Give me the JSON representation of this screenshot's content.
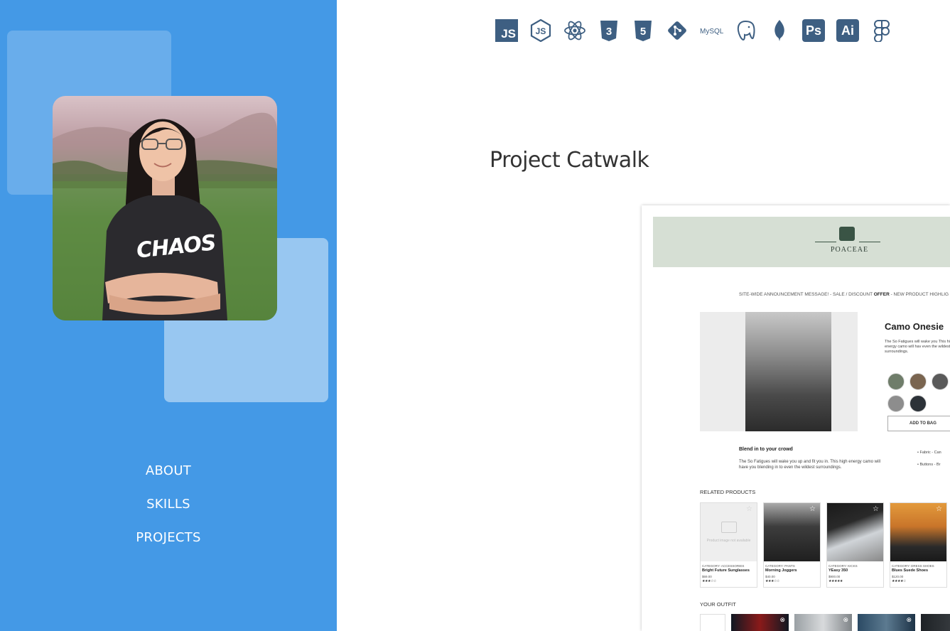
{
  "sidebar": {
    "nav": [
      {
        "label": "ABOUT"
      },
      {
        "label": "SKILLS"
      },
      {
        "label": "PROJECTS"
      }
    ],
    "portrait_shirt_text": "CHAOS",
    "colors": {
      "background": "#4499e6"
    }
  },
  "skills": [
    {
      "icon": "javascript-icon",
      "label": "JS"
    },
    {
      "icon": "nodejs-icon",
      "label": "JS"
    },
    {
      "icon": "react-icon"
    },
    {
      "icon": "css3-icon",
      "label": "3"
    },
    {
      "icon": "html5-icon",
      "label": "5"
    },
    {
      "icon": "git-icon"
    },
    {
      "icon": "mysql-icon",
      "label": "MySQL"
    },
    {
      "icon": "postgresql-icon"
    },
    {
      "icon": "mongodb-icon"
    },
    {
      "icon": "photoshop-icon",
      "label": "Ps"
    },
    {
      "icon": "illustrator-icon",
      "label": "Ai"
    },
    {
      "icon": "figma-icon"
    }
  ],
  "project": {
    "title": "Project Catwalk",
    "screenshot": {
      "brand": "POACEAE",
      "announcement_pre": "SITE-WIDE ANNOUNCEMENT MESSAGE! - SALE / DISCOUNT ",
      "announcement_bold": "OFFER",
      "announcement_post": " - NEW PRODUCT HIGHLIG",
      "product_name": "Camo Onesie",
      "product_desc": "The So Fatigues will wake you This high energy camo will hav even the wildest surroundings.",
      "add_to_bag": "ADD TO BAG",
      "blend_title": "Blend in to your crowd",
      "blend_desc": "The So Fatigues will wake you up and fit you in. This high energy camo will have you blending in to even the wildest surroundings.",
      "features": [
        "Fabric - Can",
        "Buttons - Br"
      ],
      "related_label": "RELATED PRODUCTS",
      "related": [
        {
          "category": "CATEGORY: ACCESSORIES",
          "name": "Bright Future Sunglasses",
          "price": "$69.00",
          "rating": "★★★☆☆",
          "placeholder": "Product image not available"
        },
        {
          "category": "CATEGORY: PANTS",
          "name": "Morning Joggers",
          "price": "$40.00",
          "rating": "★★★☆☆"
        },
        {
          "category": "CATEGORY: KICKS",
          "name": "YEasy 350",
          "price": "$900.00",
          "rating": "★★★★★"
        },
        {
          "category": "CATEGORY: DRESS SHOES",
          "name": "Blues Suede Shoes",
          "price": "$120.00",
          "rating": "★★★★☆"
        }
      ],
      "outfit_label": "YOUR OUTFIT"
    }
  }
}
